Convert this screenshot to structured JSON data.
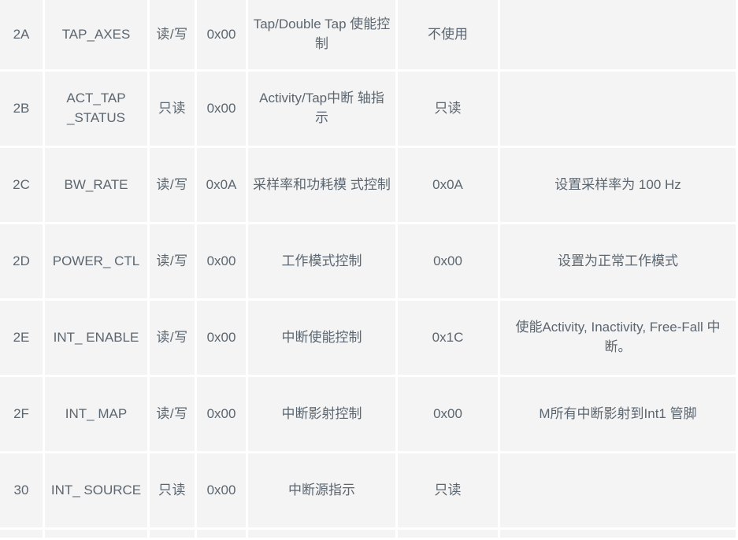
{
  "table": {
    "columns": [
      "address",
      "register_name",
      "access",
      "default_value",
      "description",
      "set_value",
      "note"
    ],
    "rows": [
      {
        "address": "2A",
        "register_name": "TAP_AXES",
        "access": "读/写",
        "default_value": "0x00",
        "description": "Tap/Double Tap 使能控制",
        "set_value": "不使用",
        "note": ""
      },
      {
        "address": "2B",
        "register_name": "ACT_TAP _STATUS",
        "access": "只读",
        "default_value": "0x00",
        "description": "Activity/Tap中断 轴指示",
        "set_value": "只读",
        "note": ""
      },
      {
        "address": "2C",
        "register_name": "BW_RATE",
        "access": "读/写",
        "default_value": "0x0A",
        "description": "采样率和功耗模 式控制",
        "set_value": "0x0A",
        "note": "设置采样率为 100 Hz"
      },
      {
        "address": "2D",
        "register_name": "POWER_ CTL",
        "access": "读/写",
        "default_value": "0x00",
        "description": "工作模式控制",
        "set_value": "0x00",
        "note": "设置为正常工作模式"
      },
      {
        "address": "2E",
        "register_name": "INT_ ENABLE",
        "access": "读/写",
        "default_value": "0x00",
        "description": "中断使能控制",
        "set_value": "0x1C",
        "note": "使能Activity, Inactivity, Free-Fall 中断。"
      },
      {
        "address": "2F",
        "register_name": "INT_ MAP",
        "access": "读/写",
        "default_value": "0x00",
        "description": "中断影射控制",
        "set_value": "0x00",
        "note": "M所有中断影射到Int1 管脚"
      },
      {
        "address": "30",
        "register_name": "INT_ SOURCE",
        "access": "只读",
        "default_value": "0x00",
        "description": "中断源指示",
        "set_value": "只读",
        "note": ""
      }
    ]
  },
  "style": {
    "cell_background": "#f4f4f4",
    "text_color": "#5b6670",
    "page_background": "#ffffff"
  }
}
